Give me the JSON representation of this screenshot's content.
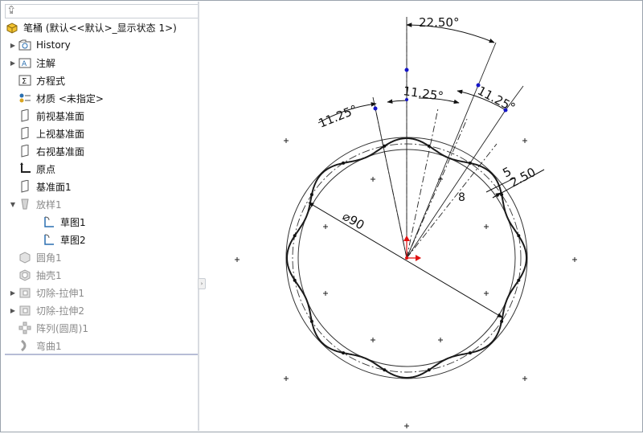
{
  "tree": {
    "root": {
      "label": "笔桶 (默认<<默认>_显示状态 1>)"
    },
    "items": [
      {
        "label": "History",
        "icon": "history-folder-icon",
        "expander": "collapsed"
      },
      {
        "label": "注解",
        "icon": "annotations-folder-icon",
        "expander": "collapsed"
      },
      {
        "label": "方程式",
        "icon": "equations-icon",
        "expander": ""
      },
      {
        "label": "材质 <未指定>",
        "icon": "material-icon",
        "expander": ""
      },
      {
        "label": "前视基准面",
        "icon": "plane-icon",
        "expander": ""
      },
      {
        "label": "上视基准面",
        "icon": "plane-icon",
        "expander": ""
      },
      {
        "label": "右视基准面",
        "icon": "plane-icon",
        "expander": ""
      },
      {
        "label": "原点",
        "icon": "origin-icon",
        "expander": ""
      },
      {
        "label": "基准面1",
        "icon": "plane-icon",
        "expander": ""
      },
      {
        "label": "放样1",
        "icon": "loft-icon",
        "expander": "expanded"
      },
      {
        "label": "草图1",
        "icon": "sketch-icon",
        "expander": ""
      },
      {
        "label": "草图2",
        "icon": "sketch-icon",
        "expander": ""
      },
      {
        "label": "圆角1",
        "icon": "fillet-icon",
        "expander": ""
      },
      {
        "label": "抽壳1",
        "icon": "shell-icon",
        "expander": ""
      },
      {
        "label": "切除-拉伸1",
        "icon": "cut-extrude-icon",
        "expander": "collapsed"
      },
      {
        "label": "切除-拉伸2",
        "icon": "cut-extrude-icon",
        "expander": "collapsed"
      },
      {
        "label": "阵列(圆周)1",
        "icon": "circular-pattern-icon",
        "expander": ""
      },
      {
        "label": "弯曲1",
        "icon": "flex-icon",
        "expander": ""
      }
    ]
  },
  "drawing": {
    "dimensions": {
      "angle_total": "22.50°",
      "angle_left": "11.25°",
      "angle_mid": "11.25°",
      "angle_right": "11.25°",
      "diameter": "⌀90",
      "offset_5": "5",
      "offset_2_50": "2.50",
      "count_8": "8"
    },
    "colors": {
      "sketch_line": "#1a1a1a",
      "point": "#1414c8",
      "origin": "#e01010"
    }
  }
}
